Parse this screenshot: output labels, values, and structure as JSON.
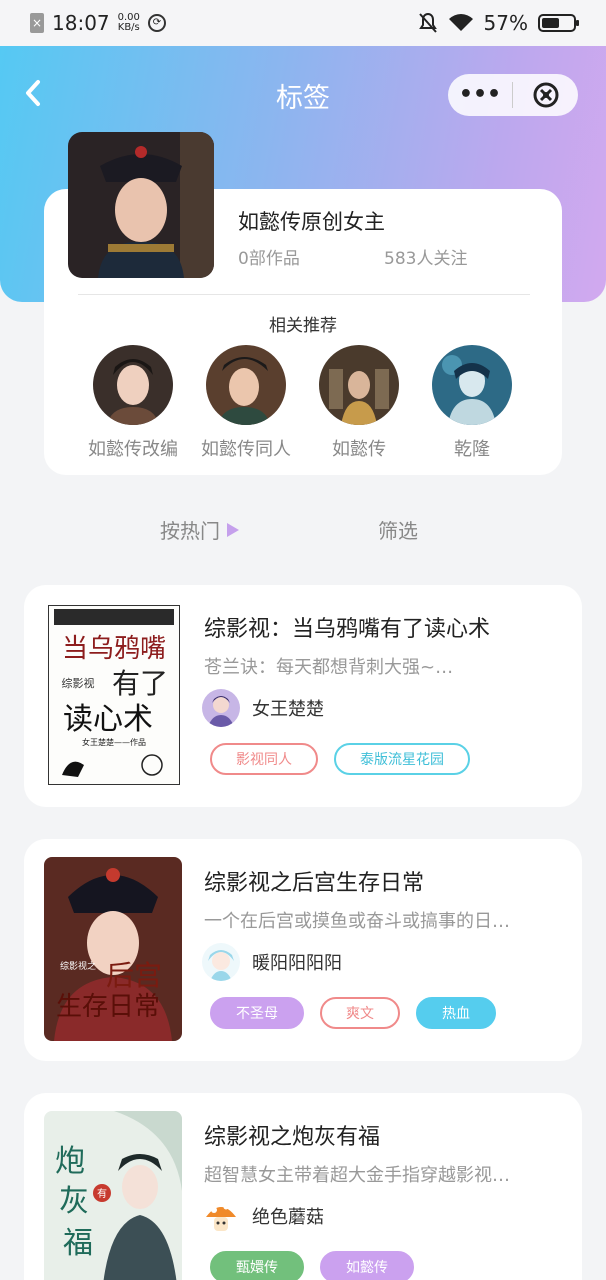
{
  "status": {
    "time": "18:07",
    "net_speed_value": "0.00",
    "net_speed_unit": "KB/s",
    "battery": "57%",
    "battery_level": 0.57
  },
  "header": {
    "title": "标签"
  },
  "tag": {
    "name": "如懿传原创女主",
    "works": "0部作品",
    "followers": "583人关注"
  },
  "related": {
    "title": "相关推荐",
    "items": [
      {
        "label": "如懿传改编"
      },
      {
        "label": "如懿传同人"
      },
      {
        "label": "如懿传"
      },
      {
        "label": "乾隆"
      }
    ]
  },
  "sort": {
    "hot": "按热门",
    "filter": "筛选"
  },
  "books": [
    {
      "title": "综影视：当乌鸦嘴有了读心术",
      "desc": "苍兰诀：每天都想背刺大强~…",
      "author": "女王楚楚",
      "cover_text": [
        "当乌鸦嘴",
        "综影视",
        "有了",
        "读心术",
        "女王楚楚——作品"
      ],
      "tags": [
        {
          "label": "影视同人",
          "style": "outline-red"
        },
        {
          "label": "泰版流星花园",
          "style": "outline-cyan"
        }
      ]
    },
    {
      "title": "综影视之后宫生存日常",
      "desc": "一个在后宫或摸鱼或奋斗或搞事的日…",
      "author": "暖阳阳阳阳",
      "cover_text": [
        "后宫",
        "生存日常",
        "综影视之"
      ],
      "tags": [
        {
          "label": "不圣母",
          "style": "purple"
        },
        {
          "label": "爽文",
          "style": "outline-red"
        },
        {
          "label": "热血",
          "style": "cyan"
        }
      ]
    },
    {
      "title": "综影视之炮灰有福",
      "desc": "超智慧女主带着超大金手指穿越影视…",
      "author": "绝色蘑菇",
      "cover_text": [
        "炮",
        "灰",
        "福",
        "有"
      ],
      "tags": [
        {
          "label": "甄嬛传",
          "style": "green"
        },
        {
          "label": "如懿传",
          "style": "purple"
        }
      ]
    }
  ]
}
